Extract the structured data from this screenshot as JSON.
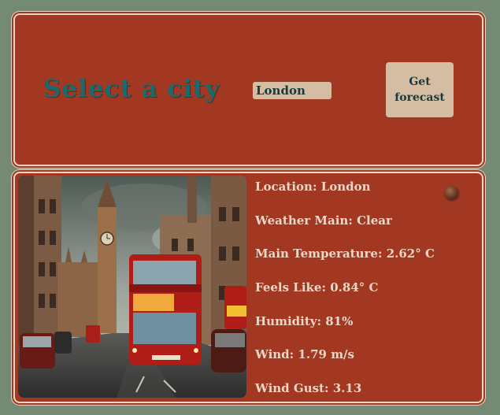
{
  "header": {
    "title": "Select a city",
    "selected_city": "London",
    "forecast_button": "Get\nforecast"
  },
  "weather": {
    "location": "Location: London",
    "main": "Weather Main: Clear",
    "temperature": "Main Temperature: 2.62° C",
    "feels_like": "Feels Like: 0.84° C",
    "humidity": "Humidity: 81%",
    "wind": "Wind: 1.79 m/s",
    "wind_gust": "Wind Gust: 3.13",
    "icon": "clear-weather-icon"
  },
  "colors": {
    "background": "#748a74",
    "panel": "#a23722",
    "accent": "#1c6a6c",
    "button": "#d4bda2"
  }
}
